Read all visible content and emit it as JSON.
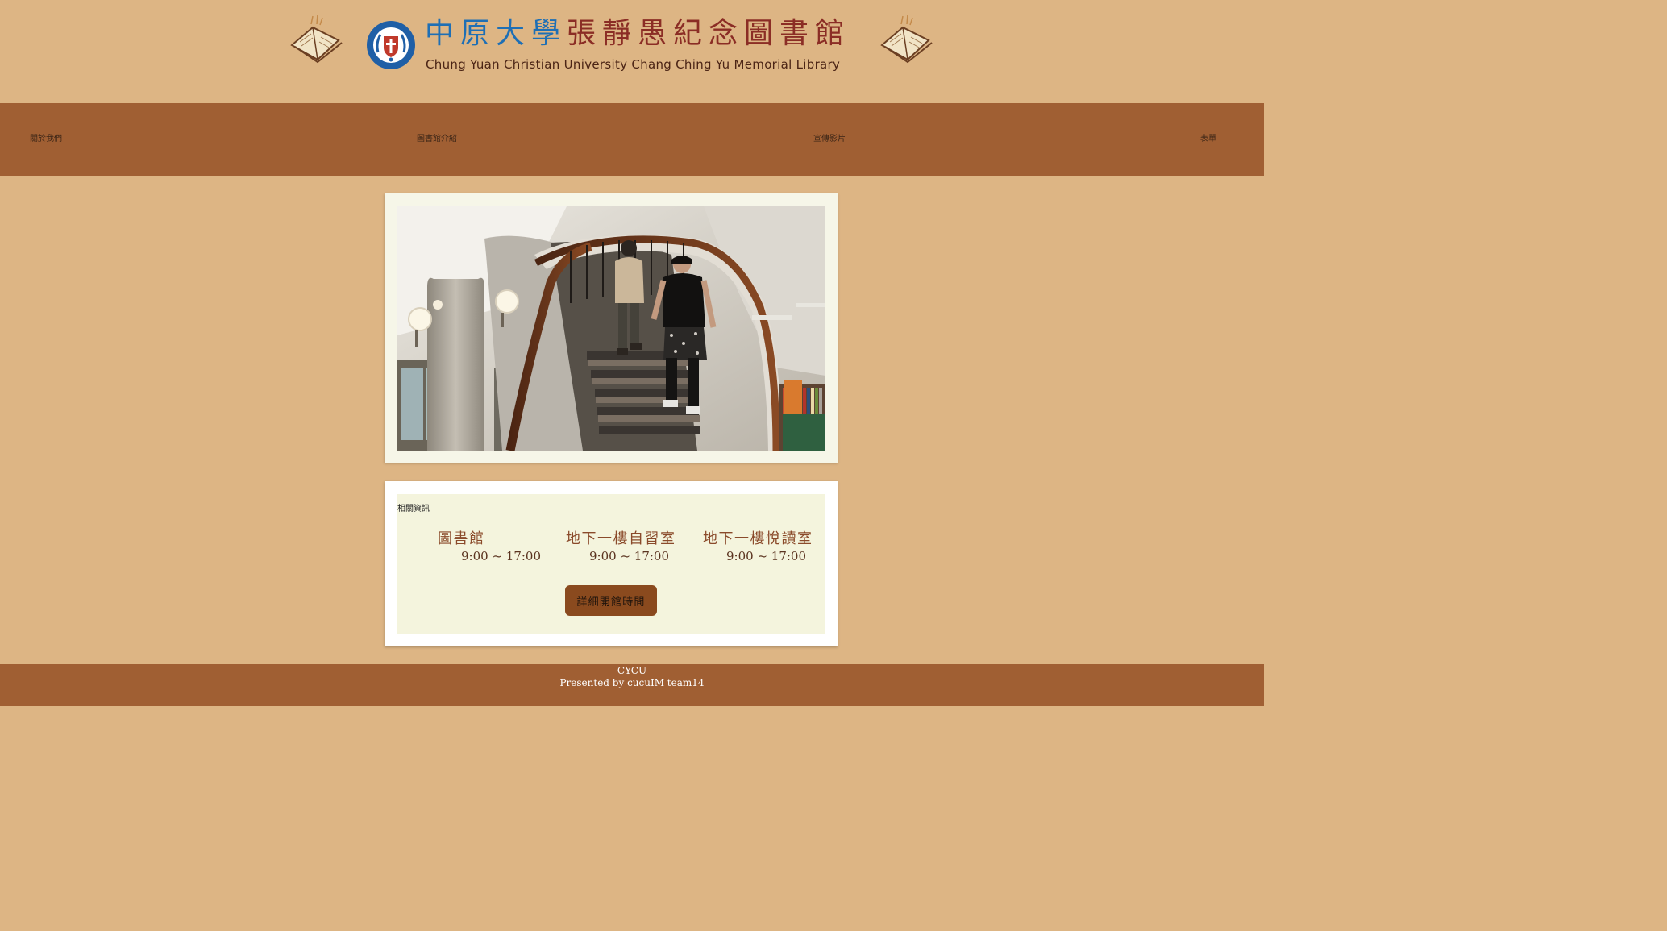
{
  "header": {
    "title_zh_part1": "中原大學",
    "title_zh_part2": "張靜愚紀念圖書館",
    "title_en": "Chung Yuan Christian University Chang Ching Yu Memorial Library",
    "colors": {
      "blue": "#1e6fb5",
      "maroon": "#8b2d25"
    }
  },
  "nav": {
    "items": [
      {
        "label": "關於我們"
      },
      {
        "label": "圖書館介紹"
      },
      {
        "label": "宣傳影片"
      },
      {
        "label": "表單"
      }
    ]
  },
  "info": {
    "heading": "相關資訊",
    "hours": [
      {
        "name": "圖書館",
        "time": "9:00 ~ 17:00"
      },
      {
        "name": "地下一樓自習室",
        "time": "9:00 ~ 17:00"
      },
      {
        "name": "地下一樓悅讀室",
        "time": "9:00 ~ 17:00"
      }
    ],
    "button_label": "詳細開館時間"
  },
  "footer": {
    "line1": "CYCU",
    "line2": "Presented by cucuIM team14"
  },
  "colors": {
    "page_bg": "#ddb584",
    "bar_bg": "#a05f33",
    "button_bg": "#8a4a1e",
    "info_bg": "#f4f4dd"
  }
}
